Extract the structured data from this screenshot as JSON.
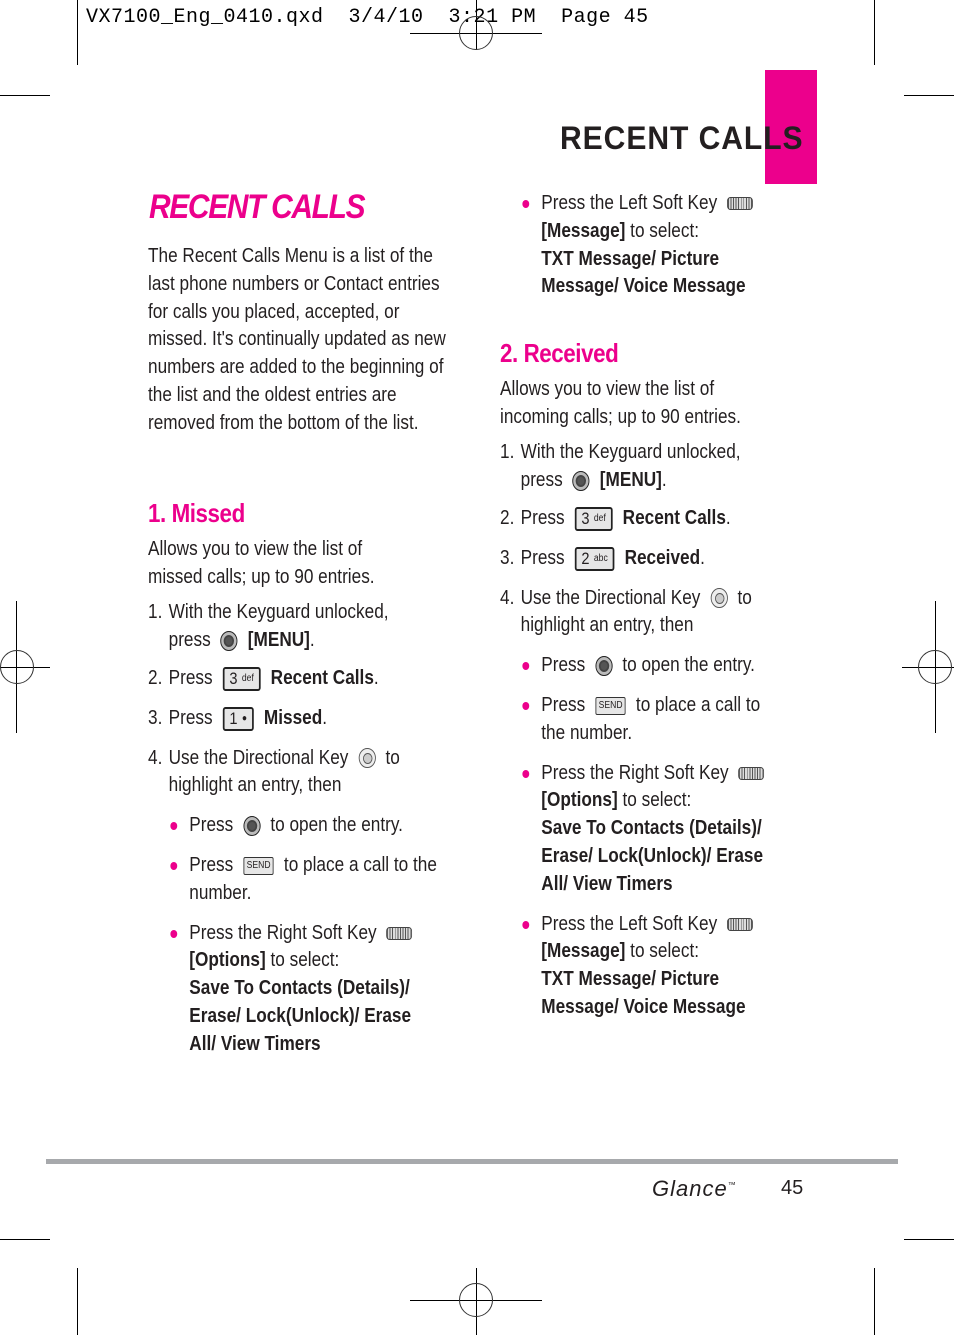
{
  "slug": "VX7100_Eng_0410.qxd  3/4/10  3:21 PM  Page 45",
  "section_tab_title": "RECENT CALLS",
  "page_title": "RECENT CALLS",
  "intro": "The Recent Calls Menu is a list of the last phone numbers or Contact entries for calls you placed, accepted, or missed. It's continually updated as new numbers are added to the beginning of the list and the oldest entries are removed from the bottom of the list.",
  "missed": {
    "heading": "1. Missed",
    "desc": "Allows you to view the list of missed calls; up to 90 entries.",
    "step1_a": "With the Keyguard unlocked,",
    "step1_press": "press",
    "step1_b": "[MENU]",
    "step2_press": "Press",
    "step2_key": "3",
    "step2_key_sub": "def",
    "step2_b": "Recent Calls",
    "step3_press": "Press",
    "step3_key": "1",
    "step3_key_sub": "·ᐧ",
    "step3_b": "Missed",
    "step4_a": "Use the Directional Key",
    "step4_b": "to highlight an entry, then",
    "bullet1_a": "Press",
    "bullet1_b": "to open the entry.",
    "bullet2_a": "Press",
    "send_label": "SEND",
    "bullet2_b": "to place a call to the number.",
    "bullet3_a": "Press the Right Soft Key",
    "bullet3_opt": "[Options]",
    "bullet3_b": "to select:",
    "bullet3_list": "Save To Contacts (Details)/ Erase/ Lock(Unlock)/ Erase All/ View Timers",
    "bullet4_a": "Press the Left Soft Key",
    "bullet4_opt": "[Message]",
    "bullet4_b": "to select:",
    "bullet4_list": "TXT Message/ Picture Message/ Voice Message"
  },
  "received": {
    "heading": "2. Received",
    "desc": "Allows you to view the list of incoming calls; up to 90 entries.",
    "step1_a": "With the Keyguard unlocked,",
    "step1_press": "press",
    "step1_b": "[MENU]",
    "step2_press": "Press",
    "step2_key": "3",
    "step2_key_sub": "def",
    "step2_b": "Recent Calls",
    "step3_press": "Press",
    "step3_key": "2",
    "step3_key_sub": "abc",
    "step3_b": "Received",
    "step4_a": "Use the Directional Key",
    "step4_b": "to highlight an entry, then",
    "bullet1_a": "Press",
    "bullet1_b": "to open the entry.",
    "bullet2_a": "Press",
    "send_label": "SEND",
    "bullet2_b": "to place a call to the number.",
    "bullet3_a": "Press the Right Soft Key",
    "bullet3_opt": "[Options]",
    "bullet3_b": "to select:",
    "bullet3_list": "Save To Contacts (Details)/ Erase/ Lock(Unlock)/ Erase All/ View Timers",
    "bullet4_a": "Press the Left Soft Key",
    "bullet4_opt": "[Message]",
    "bullet4_b": "to select:",
    "bullet4_list": "TXT Message/ Picture Message/ Voice Message"
  },
  "footer": {
    "brand": "Glance",
    "tm": "™",
    "page_number": "45"
  },
  "colors": {
    "accent": "#ec008c",
    "text": "#231f20",
    "rule": "#a7a9ac"
  }
}
